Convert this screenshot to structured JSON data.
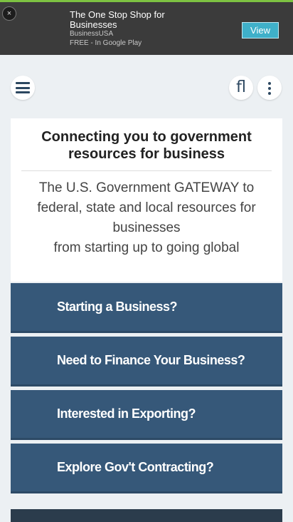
{
  "app_banner": {
    "close_glyph": "×",
    "title": "The One Stop Shop for Businesses",
    "publisher": "BusinessUSA",
    "store_line": "FREE - In Google Play",
    "view_label": "View",
    "accent_color": "#7dc242"
  },
  "nav": {
    "menu_icon": "hamburger-menu-icon",
    "brand_icon": "fl-ligature-icon",
    "brand_glyph": "ﬂ",
    "more_icon": "vertical-dots-icon"
  },
  "intro": {
    "heading": "Connecting you to government resources for business",
    "description": "The U.S. Government GATEWAY to federal, state and local resources for businesses",
    "tagline": "from starting up to going global"
  },
  "topics": [
    {
      "label": "Starting a Business?"
    },
    {
      "label": "Need to Finance Your Business?"
    },
    {
      "label": "Interested in Exporting?"
    },
    {
      "label": "Explore Gov't Contracting?"
    }
  ],
  "colors": {
    "topic_bg": "#365879",
    "page_bg": "#ecf0f3",
    "banner_bg": "#3b3b3b"
  }
}
